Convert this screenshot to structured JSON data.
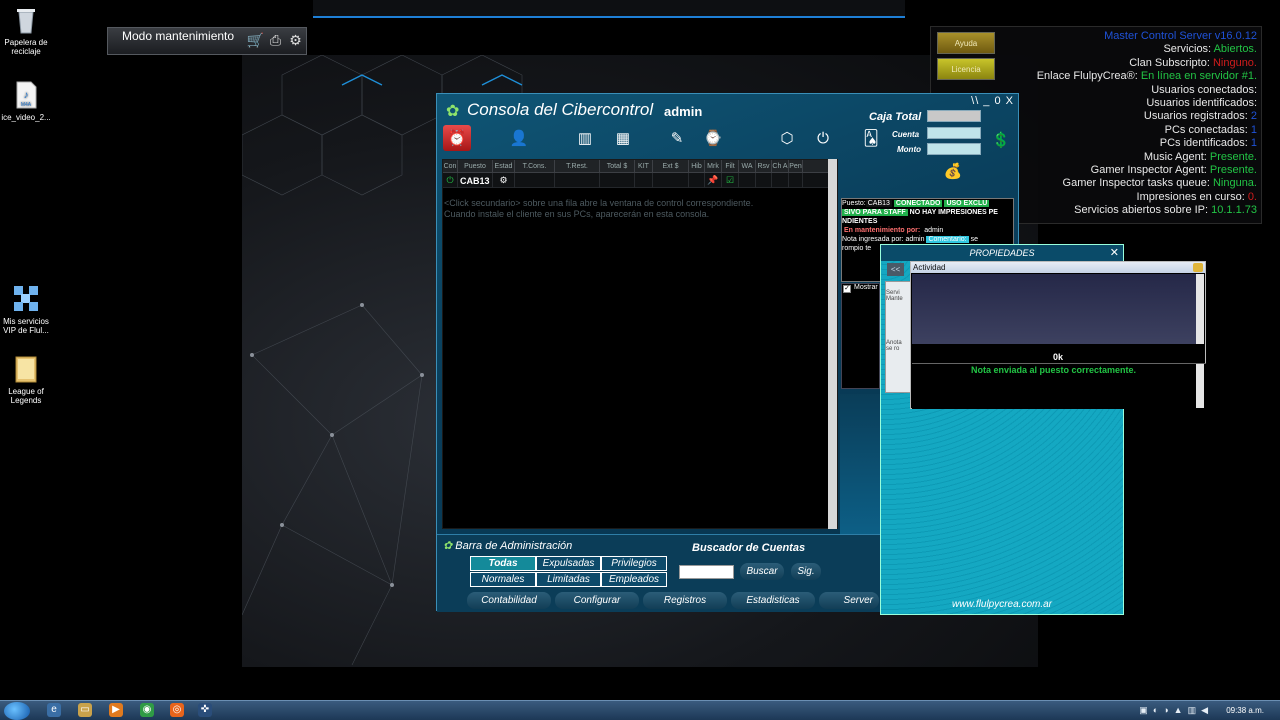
{
  "desktop": {
    "icons": [
      {
        "label": "Papelera de reciclaje",
        "icon": "recycle-bin-icon"
      },
      {
        "label": "ice_video_2...",
        "icon": "audio-file-icon"
      },
      {
        "label": "Mis servicios VIP de Flul...",
        "icon": "vip-services-icon"
      },
      {
        "label": "League of Legends",
        "icon": "folder-icon"
      }
    ]
  },
  "maintenance_bar": {
    "label": "Modo mantenimiento",
    "icons": [
      "cart-icon",
      "printer-icon",
      "gear-icon"
    ]
  },
  "master_control": {
    "help_label": "Ayuda",
    "license_label": "Licencia",
    "title": "Master Control Server v16.0.12",
    "rows": [
      {
        "label": "Servicios: ",
        "value": "Abiertos.",
        "color": "#22c445"
      },
      {
        "label": "Clan Subscripto: ",
        "value": "Ninguno.",
        "color": "#d01c1c"
      },
      {
        "label": "Enlace FlulpyCrea®: ",
        "value": "En línea en servidor #1.",
        "color": "#22c445"
      },
      {
        "label": "Usuarios conectados: ",
        "value": "",
        "color": "#1f52d8"
      },
      {
        "label": "Usuarios identificados: ",
        "value": "",
        "color": "#1f52d8"
      },
      {
        "label": "Usuarios registrados: ",
        "value": "2",
        "color": "#1f52d8"
      },
      {
        "label": "PCs conectadas: ",
        "value": "1",
        "color": "#1f52d8"
      },
      {
        "label": "PCs identificados: ",
        "value": "1",
        "color": "#1f52d8"
      },
      {
        "label": "Music Agent: ",
        "value": "Presente.",
        "color": "#22c445"
      },
      {
        "label": "Gamer Inspector Agent: ",
        "value": "Presente.",
        "color": "#22c445"
      },
      {
        "label": "Gamer Inspector tasks queue: ",
        "value": "Ninguna.",
        "color": "#22c445"
      },
      {
        "label": "Impresiones en curso: ",
        "value": "0.",
        "color": "#d01c1c"
      },
      {
        "label": "Servicios abiertos sobre IP: ",
        "value": "10.1.1.73",
        "color": "#22c445"
      }
    ]
  },
  "console": {
    "title": "Consola del Cibercontrol",
    "user": "admin",
    "window_controls": "\\\\ _ 0 X",
    "caja": {
      "total": "Caja Total",
      "cuenta": "Cuenta",
      "monto": "Monto"
    },
    "grid": {
      "headers": [
        "Con",
        "Puesto",
        "Estad",
        "T.Cons.",
        "T.Rest.",
        "Total $",
        "KIT",
        "Ext $",
        "Hib",
        "Mrk",
        "Filt",
        "WA",
        "Rsv",
        "Ch A",
        "Pen"
      ],
      "rows": [
        {
          "puesto": "CAB13"
        }
      ],
      "hint_line1": "<Click secundario> sobre una fila abre la ventana de control correspondiente.",
      "hint_line2": "Cuando instale el cliente en sus PCs, aparecerán en esta consola."
    },
    "right_panel": {
      "puesto_label": "Puesto:",
      "puesto_value": "CAB13",
      "estado": "CONECTADO",
      "uso": "USO EXCLU",
      "sivo": "SIVO PARA STAFF",
      "no_impresiones": "NO HAY IMPRESIONES PE",
      "ndientes": "NDIENTES",
      "mant_label": "En mantenimiento por:",
      "mant_value": "admin",
      "nota_label": "Nota ingresada por:",
      "nota_value": "admin",
      "comentario": "Comentario:",
      "se": "se",
      "rompio": "rompio te",
      "mostrar": "Mostrar"
    },
    "admin_bar": {
      "title": "Barra de Administración",
      "search_title": "Buscador de Cuentas",
      "filters": [
        "Todas",
        "Expulsadas",
        "Privilegios",
        "Normales",
        "Limitadas",
        "Empleados"
      ],
      "search_button": "Buscar",
      "next_button": "Sig.",
      "bottom": [
        "Contabilidad",
        "Configurar",
        "Registros",
        "Estadisticas",
        "Server"
      ]
    }
  },
  "properties": {
    "title": "PROPIEDADES",
    "nav": "<<",
    "side_texts": [
      "Servi",
      "Mante",
      "Anota",
      "se ro"
    ],
    "url": "www.flulpycrea.com.ar"
  },
  "activity": {
    "title": "Actividad",
    "ok": "0k",
    "message": "Nota enviada al puesto correctamente."
  },
  "taskbar": {
    "clock": "09:38 a.m."
  }
}
